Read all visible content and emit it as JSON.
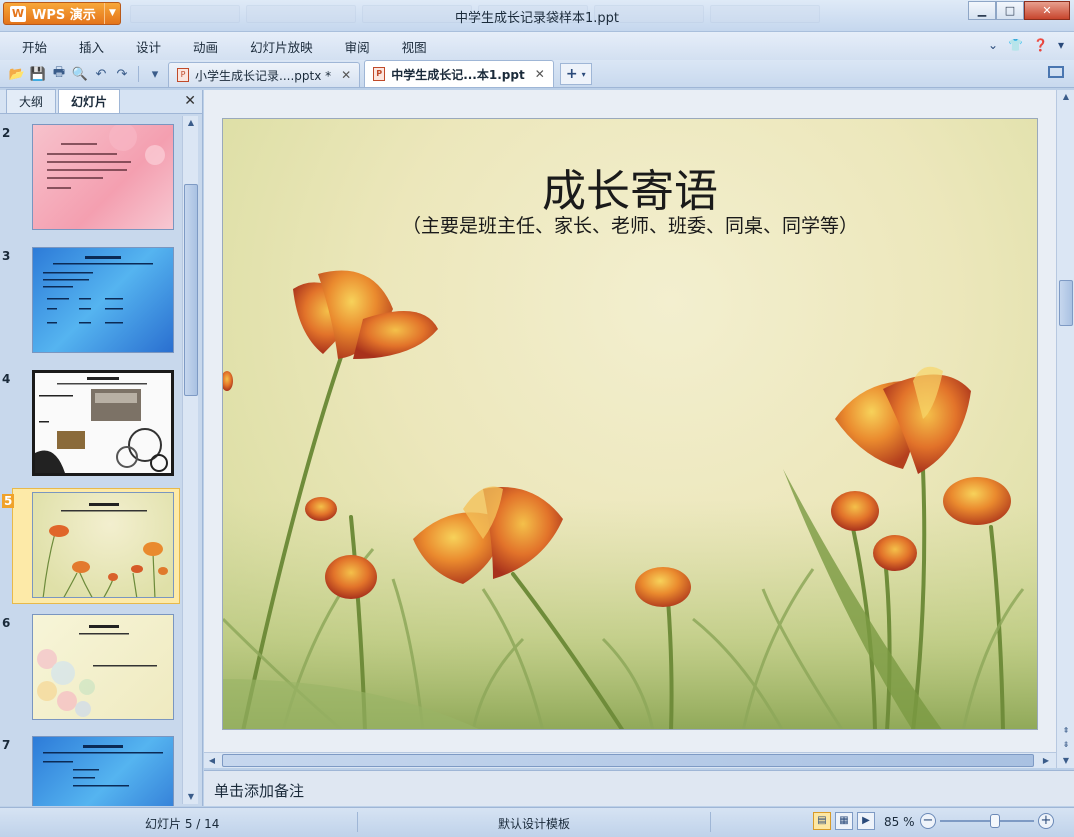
{
  "app": {
    "button_label": "WPS 演示",
    "window_title": "中学生成长记录袋样本1.ppt"
  },
  "menu": {
    "items": [
      "开始",
      "插入",
      "设计",
      "动画",
      "幻灯片放映",
      "审阅",
      "视图"
    ]
  },
  "doc_tabs": [
    {
      "label": "小学生成长记录....pptx *",
      "active": false
    },
    {
      "label": "中学生成长记...本1.ppt",
      "active": true
    }
  ],
  "panel": {
    "tabs": [
      "大纲",
      "幻灯片"
    ],
    "active_tab": "幻灯片"
  },
  "thumbnails": [
    {
      "number": "2",
      "theme": "pink"
    },
    {
      "number": "3",
      "theme": "blue"
    },
    {
      "number": "4",
      "theme": "bw-photo"
    },
    {
      "number": "5",
      "theme": "flower",
      "selected": true
    },
    {
      "number": "6",
      "theme": "pastel-flower"
    },
    {
      "number": "7",
      "theme": "blue"
    }
  ],
  "slide": {
    "title": "成长寄语",
    "subtitle": "（主要是班主任、家长、老师、班委、同桌、同学等）"
  },
  "notes": {
    "placeholder": "单击添加备注"
  },
  "status": {
    "slide_info": "幻灯片 5 / 14",
    "template": "默认设计模板",
    "zoom": "85 %",
    "zoom_percent": 85
  },
  "colors": {
    "accent_orange": "#e4741a",
    "selected_thumb": "#fdeaa8",
    "chrome_blue": "#c8d9ee"
  }
}
